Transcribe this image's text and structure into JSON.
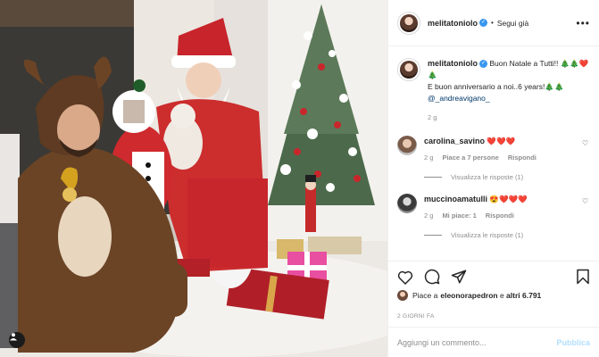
{
  "post": {
    "author": "melitatoniolo",
    "follow_label": "Segui già",
    "more_label": "•••"
  },
  "caption": {
    "author": "melitatoniolo",
    "line1": "Buon Natale a Tutti!! 🎄🎄❤️🎄",
    "line2": "E buon anniversario a noi..6 years!🎄🎄",
    "mention": "@_andreavigano_",
    "time": "2 g"
  },
  "comments": [
    {
      "author": "carolina_savino",
      "text": "❤️❤️❤️",
      "time": "2 g",
      "likes": "Piace a 7 persone",
      "reply": "Rispondi",
      "view_replies": "Visualizza le risposte (1)"
    },
    {
      "author": "muccinoamatulli",
      "text": "😍❤️❤️❤️",
      "time": "2 g",
      "likes": "Mi piace: 1",
      "reply": "Rispondi",
      "view_replies": "Visualizza le risposte (1)"
    }
  ],
  "likes_line": {
    "prefix": "Piace a ",
    "user": "eleonorapedron",
    "suffix": " e ",
    "others": "altri 6.791"
  },
  "date_label": "2 GIORNI FA",
  "add_comment": {
    "placeholder": "Aggiungi un commento...",
    "publish_label": "Pubblica"
  },
  "icons": {
    "like": "heart-icon",
    "comment": "comment-icon",
    "share": "share-icon",
    "save": "bookmark-icon",
    "verified": "verified-badge-icon"
  },
  "colors": {
    "verified": "#3897f0",
    "mention": "#00376b",
    "meta": "#8e8e8e",
    "publish": "#b2dffc"
  }
}
